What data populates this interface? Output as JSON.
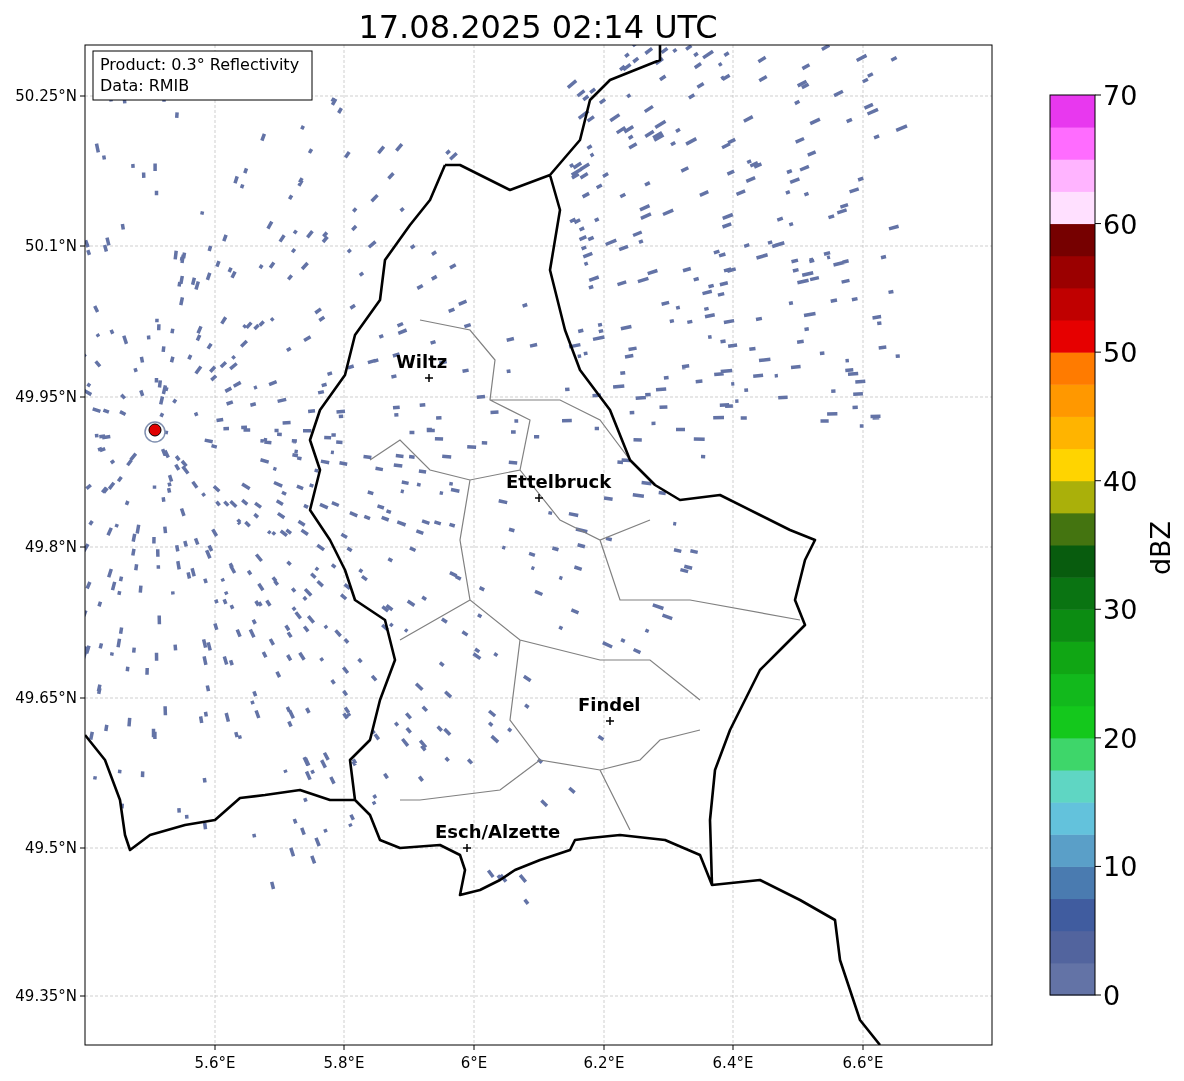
{
  "title": "17.08.2025 02:14 UTC",
  "info_box": {
    "lines": [
      "Product: 0.3° Reflectivity",
      "Data: RMIB"
    ]
  },
  "map": {
    "lat_ticks": [
      "50.25°N",
      "50.1°N",
      "49.95°N",
      "49.8°N",
      "49.65°N",
      "49.5°N",
      "49.35°N"
    ],
    "lon_ticks": [
      "5.6°E",
      "5.8°E",
      "6°E",
      "6.2°E",
      "6.4°E",
      "6.6°E"
    ],
    "cities": [
      {
        "name": "Wiltz"
      },
      {
        "name": "Ettelbruck"
      },
      {
        "name": "Findel"
      },
      {
        "name": "Esch/Alzette"
      }
    ]
  },
  "colorbar": {
    "label": "dBZ",
    "ticks": [
      "70",
      "60",
      "50",
      "40",
      "30",
      "20",
      "10",
      "0"
    ],
    "bands": [
      {
        "color": "#6373a6"
      },
      {
        "color": "#52649e"
      },
      {
        "color": "#405c9f"
      },
      {
        "color": "#4a7bb0"
      },
      {
        "color": "#5a9fc8"
      },
      {
        "color": "#63c2dc"
      },
      {
        "color": "#5fd6c3"
      },
      {
        "color": "#3ed66a"
      },
      {
        "color": "#14c81c"
      },
      {
        "color": "#12b91c"
      },
      {
        "color": "#10a614"
      },
      {
        "color": "#0c8c12"
      },
      {
        "color": "#0a7412"
      },
      {
        "color": "#085c0e"
      },
      {
        "color": "#447410"
      },
      {
        "color": "#aab00a"
      },
      {
        "color": "#ffd400"
      },
      {
        "color": "#ffb400"
      },
      {
        "color": "#ff9800"
      },
      {
        "color": "#ff7b00"
      },
      {
        "color": "#e60000"
      },
      {
        "color": "#c00000"
      },
      {
        "color": "#9b0000"
      },
      {
        "color": "#760000"
      },
      {
        "color": "#ffe0ff"
      },
      {
        "color": "#ffb4ff"
      },
      {
        "color": "#ff6cff"
      },
      {
        "color": "#e838ef"
      }
    ]
  }
}
